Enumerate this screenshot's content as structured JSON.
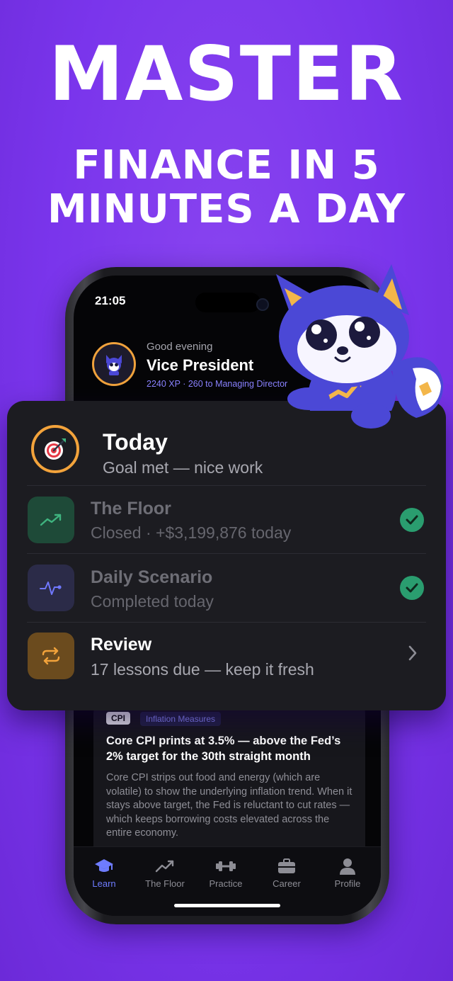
{
  "hero": {
    "line1": "MASTER",
    "line2": "FINANCE IN 5",
    "line3": "MINUTES A DAY"
  },
  "status_bar": {
    "time": "21:05"
  },
  "greeting": {
    "small": "Good evening",
    "title": "Vice President",
    "xp": "2240 XP · 260 to Managing Director"
  },
  "today_card": {
    "title": "Today",
    "subtitle": "Goal met — nice work",
    "items": [
      {
        "title": "The Floor",
        "subtitle": "Closed · +$3,199,876 today",
        "status": "done",
        "icon": "trend-up-icon"
      },
      {
        "title": "Daily Scenario",
        "subtitle": "Completed today",
        "status": "done",
        "icon": "pulse-icon"
      },
      {
        "title": "Review",
        "subtitle": "17 lessons due — keep it fresh",
        "status": "open",
        "icon": "repeat-icon"
      }
    ]
  },
  "news": {
    "tag": "CPI",
    "topic": "Inflation Measures",
    "title": "Core CPI prints at 3.5% — above the Fed’s 2% target for the 30th straight month",
    "body": "Core CPI strips out food and energy (which are volatile) to show the underlying inflation trend. When it stays above target, the Fed is reluctant to cut rates — which keeps borrowing costs elevated across the entire economy."
  },
  "tabs": [
    {
      "label": "Learn",
      "active": true,
      "icon": "graduation-cap-icon"
    },
    {
      "label": "The Floor",
      "active": false,
      "icon": "trend-up-icon"
    },
    {
      "label": "Practice",
      "active": false,
      "icon": "dumbbell-icon"
    },
    {
      "label": "Career",
      "active": false,
      "icon": "briefcase-icon"
    },
    {
      "label": "Profile",
      "active": false,
      "icon": "person-icon"
    }
  ],
  "colors": {
    "background": "#7a35ec",
    "accent_orange": "#f3a33b",
    "accent_blue": "#6e7cff",
    "check_green": "#2a9d6f"
  }
}
